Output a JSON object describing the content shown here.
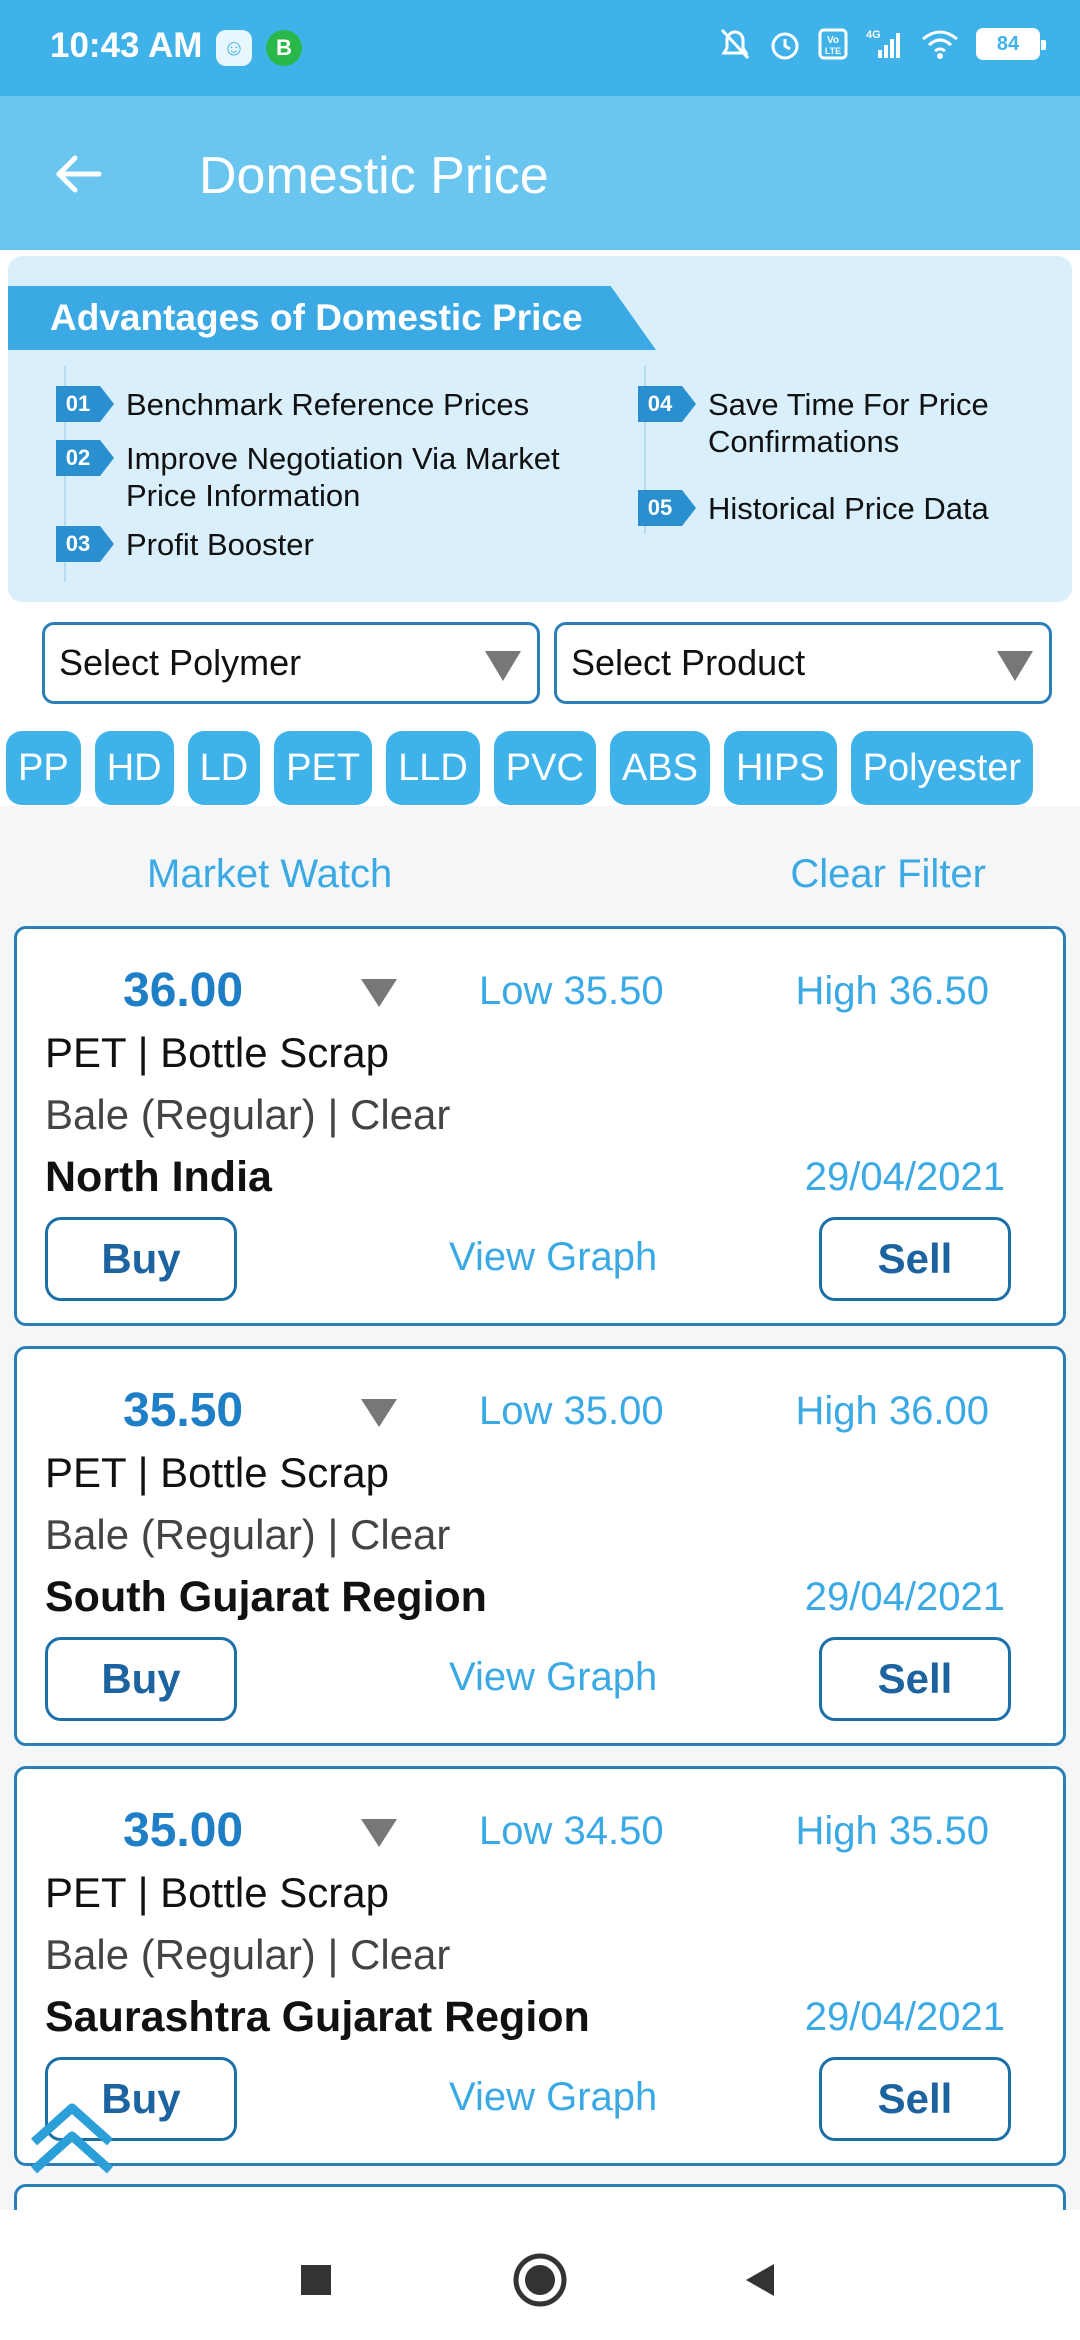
{
  "status_bar": {
    "time": "10:43 AM",
    "battery": "84",
    "icons": [
      "app-icon",
      "whatsapp-business-icon",
      "mute-icon",
      "alarm-icon",
      "volte-icon",
      "signal-icon",
      "wifi-icon",
      "battery-icon"
    ]
  },
  "header": {
    "title": "Domestic Price",
    "back_icon": "arrow-left-icon"
  },
  "advantages": {
    "title": "Advantages of Domestic Price",
    "items": [
      {
        "num": "01",
        "text": "Benchmark Reference Prices"
      },
      {
        "num": "02",
        "text": "Improve Negotiation Via Market Price Information"
      },
      {
        "num": "03",
        "text": "Profit Booster"
      },
      {
        "num": "04",
        "text": "Save Time For Price Confirmations"
      },
      {
        "num": "05",
        "text": "Historical Price Data"
      }
    ]
  },
  "filters": {
    "polymer_placeholder": "Select Polymer",
    "product_placeholder": "Select Product"
  },
  "chips": [
    "PP",
    "HD",
    "LD",
    "PET",
    "LLD",
    "PVC",
    "ABS",
    "HIPS",
    "Polyester"
  ],
  "market": {
    "market_watch": "Market Watch",
    "clear_filter": "Clear Filter"
  },
  "cards": [
    {
      "price": "36.00",
      "low": "Low 35.50",
      "high": "High 36.50",
      "product": "PET | Bottle Scrap",
      "grade": "Bale (Regular) | Clear",
      "region": "North India",
      "date": "29/04/2021",
      "buy": "Buy",
      "graph": "View Graph",
      "sell": "Sell"
    },
    {
      "price": "35.50",
      "low": "Low 35.00",
      "high": "High 36.00",
      "product": "PET | Bottle Scrap",
      "grade": "Bale (Regular) | Clear",
      "region": "South Gujarat Region",
      "date": "29/04/2021",
      "buy": "Buy",
      "graph": "View Graph",
      "sell": "Sell"
    },
    {
      "price": "35.00",
      "low": "Low 34.50",
      "high": "High 35.50",
      "product": "PET | Bottle Scrap",
      "grade": "Bale (Regular) | Clear",
      "region": "Saurashtra Gujarat Region",
      "date": "29/04/2021",
      "buy": "Buy",
      "graph": "View Graph",
      "sell": "Sell"
    }
  ],
  "colors": {
    "status_bar": "#3fb3e9",
    "app_bar": "#6ac6ef",
    "accent": "#3aa9e4",
    "border": "#2a7fb8",
    "price": "#1f7fc6"
  }
}
